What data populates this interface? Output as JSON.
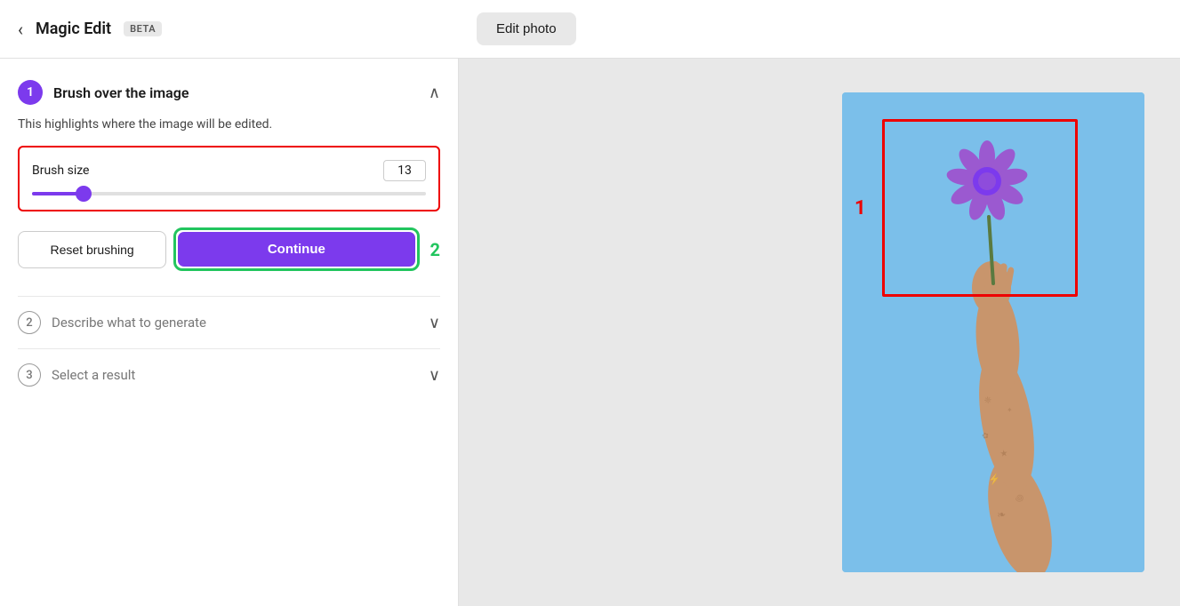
{
  "header": {
    "back_label": "‹",
    "title": "Magic Edit",
    "beta": "BETA",
    "edit_photo_label": "Edit photo"
  },
  "left_panel": {
    "step1": {
      "number": "1",
      "title": "Brush over the image",
      "description": "This highlights where the image will be edited.",
      "brush_size_label": "Brush size",
      "brush_size_value": "13",
      "reset_label": "Reset brushing",
      "continue_label": "Continue"
    },
    "step2": {
      "number": "2",
      "title": "Describe what to generate"
    },
    "step3": {
      "number": "3",
      "title": "Select a result"
    }
  },
  "annotations": {
    "photo_label": "1",
    "continue_label": "2"
  },
  "colors": {
    "purple": "#7c3aed",
    "red": "#e00000",
    "green": "#22c55e"
  }
}
